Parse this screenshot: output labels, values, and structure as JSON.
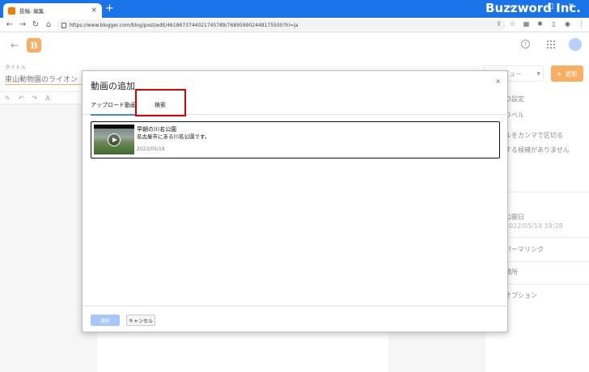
{
  "browser": {
    "tab_title": "投稿: 編集",
    "new_tab_label": "+",
    "url": "https://www.blogger.com/blog/post/edit/4618673744021745789/768959902448175500?hl=ja",
    "brand": "Buzzword Inc."
  },
  "editor": {
    "title_label": "タイトル",
    "post_title": "東山動物園のライオン",
    "preview_label": "プレビュー",
    "update_label": "更新"
  },
  "side_panel": {
    "settings": "の設定",
    "labels": "ラベル",
    "comma_hint": "ルをカンマで区切る",
    "no_candidates": "する候補がありません",
    "published": "公開日",
    "published_date": "2022/05/19 19:28",
    "permalink": "パーマリンク",
    "location": "場所",
    "options": "オプション"
  },
  "dialog": {
    "title": "動画の追加",
    "close": "×",
    "tabs": {
      "upload": "アップロード動画",
      "search": "検索"
    },
    "video": {
      "title": "早朝の川名公園",
      "description": "名古屋市にある川名公園です。",
      "date": "2022/05/19"
    },
    "select_label": "選択",
    "cancel_label": "キャンセル"
  }
}
